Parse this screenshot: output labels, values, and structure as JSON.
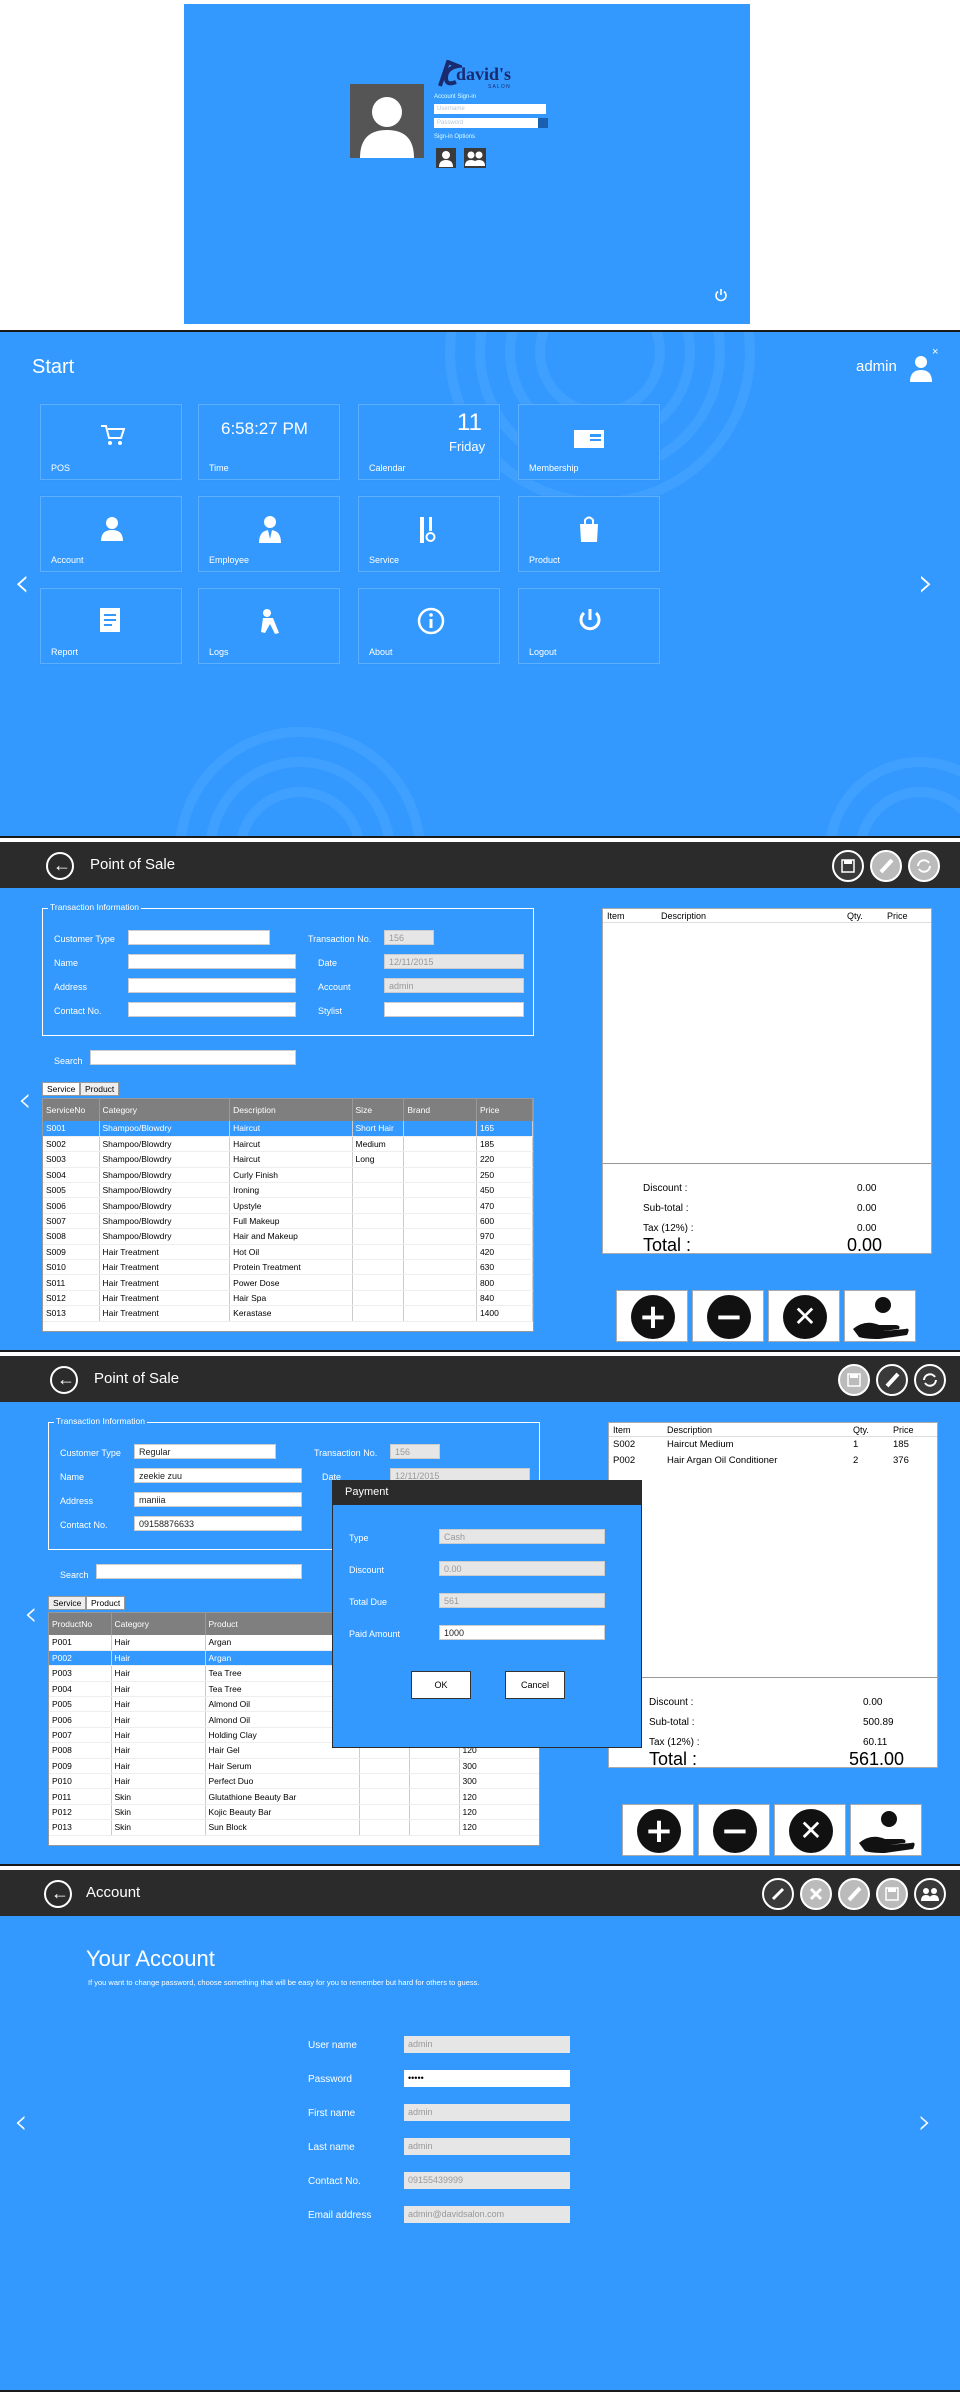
{
  "login": {
    "logo_text": "david's",
    "logo_sub": "S A L O N",
    "signin_label": "Account Sign-in",
    "username_placeholder": "Username",
    "password_placeholder": "Password",
    "signin_as_label": "Sign-in Options"
  },
  "start": {
    "title": "Start",
    "user": "admin",
    "tiles": [
      {
        "label": "POS",
        "icon": "cart-icon"
      },
      {
        "label": "Time",
        "icon": "clock",
        "value": "6:58:27 PM"
      },
      {
        "label": "Calendar",
        "icon": "calendar",
        "day": "11",
        "weekday": "Friday"
      },
      {
        "label": "Membership",
        "icon": "card-icon"
      },
      {
        "label": "Account",
        "icon": "user-icon"
      },
      {
        "label": "Employee",
        "icon": "employee-icon"
      },
      {
        "label": "Service",
        "icon": "scissors-icon"
      },
      {
        "label": "Product",
        "icon": "bag-icon"
      },
      {
        "label": "Report",
        "icon": "report-icon"
      },
      {
        "label": "Logs",
        "icon": "logs-icon"
      },
      {
        "label": "About",
        "icon": "info-icon"
      },
      {
        "label": "Logout",
        "icon": "power-icon"
      }
    ]
  },
  "pos1": {
    "title": "Point of Sale",
    "section": "Transaction Information",
    "labels": {
      "customer_type": "Customer Type",
      "name": "Name",
      "address": "Address",
      "contact": "Contact No.",
      "trans_no": "Transaction No.",
      "date": "Date",
      "account": "Account",
      "stylist": "Stylist",
      "search": "Search"
    },
    "values": {
      "customer_type": "",
      "name": "",
      "address": "",
      "contact": "",
      "trans_no": "156",
      "date": "12/11/2015",
      "account": "admin",
      "stylist": ""
    },
    "tabs": [
      "Service",
      "Product"
    ],
    "columns": [
      "ServiceNo",
      "Category",
      "Description",
      "Size",
      "Brand",
      "Price"
    ],
    "rows": [
      [
        "S001",
        "Shampoo/Blowdry",
        "Haircut",
        "Short Hair",
        "",
        "165"
      ],
      [
        "S002",
        "Shampoo/Blowdry",
        "Haircut",
        "Medium",
        "",
        "185"
      ],
      [
        "S003",
        "Shampoo/Blowdry",
        "Haircut",
        "Long",
        "",
        "220"
      ],
      [
        "S004",
        "Shampoo/Blowdry",
        "Curly Finish",
        "",
        "",
        "250"
      ],
      [
        "S005",
        "Shampoo/Blowdry",
        "Ironing",
        "",
        "",
        "450"
      ],
      [
        "S006",
        "Shampoo/Blowdry",
        "Upstyle",
        "",
        "",
        "470"
      ],
      [
        "S007",
        "Shampoo/Blowdry",
        "Full Makeup",
        "",
        "",
        "600"
      ],
      [
        "S008",
        "Shampoo/Blowdry",
        "Hair and Makeup",
        "",
        "",
        "970"
      ],
      [
        "S009",
        "Hair Treatment",
        "Hot Oil",
        "",
        "",
        "420"
      ],
      [
        "S010",
        "Hair Treatment",
        "Protein Treatment",
        "",
        "",
        "630"
      ],
      [
        "S011",
        "Hair Treatment",
        "Power Dose",
        "",
        "",
        "800"
      ],
      [
        "S012",
        "Hair Treatment",
        "Hair Spa",
        "",
        "",
        "840"
      ],
      [
        "S013",
        "Hair Treatment",
        "Kerastase",
        "",
        "",
        "1400"
      ]
    ],
    "cart_cols": [
      "Item",
      "Description",
      "Qty.",
      "Price"
    ],
    "cart_rows": [],
    "totals": {
      "discount_l": "Discount   :",
      "discount": "0.00",
      "subtotal_l": "Sub-total   :",
      "subtotal": "0.00",
      "tax_l": "Tax (12%)  :",
      "tax": "0.00",
      "total_l": "Total   :",
      "total": "0.00"
    }
  },
  "pos2": {
    "title": "Point of Sale",
    "section": "Transaction Information",
    "values": {
      "customer_type": "Regular",
      "name": "zeekie zuu",
      "address": "maniia",
      "contact": "09158876633",
      "trans_no": "156",
      "date": "12/11/2015"
    },
    "labels": {
      "customer_type": "Customer Type",
      "name": "Name",
      "address": "Address",
      "contact": "Contact No.",
      "trans_no": "Transaction No.",
      "date": "Date",
      "search": "Search"
    },
    "tabs": [
      "Service",
      "Product"
    ],
    "columns": [
      "ProductNo",
      "Category",
      "Product",
      "",
      "",
      ""
    ],
    "rows": [
      [
        "P001",
        "Hair",
        "Argan",
        "",
        "",
        ""
      ],
      [
        "P002",
        "Hair",
        "Argan",
        "",
        "",
        ""
      ],
      [
        "P003",
        "Hair",
        "Tea Tree",
        "",
        "",
        ""
      ],
      [
        "P004",
        "Hair",
        "Tea Tree",
        "",
        "",
        ""
      ],
      [
        "P005",
        "Hair",
        "Almond Oil",
        "",
        "",
        ""
      ],
      [
        "P006",
        "Hair",
        "Almond Oil",
        "",
        "",
        ""
      ],
      [
        "P007",
        "Hair",
        "Holding Clay",
        "",
        "",
        ""
      ],
      [
        "P008",
        "Hair",
        "Hair Gel",
        "",
        "",
        "120"
      ],
      [
        "P009",
        "Hair",
        "Hair Serum",
        "",
        "",
        "300"
      ],
      [
        "P010",
        "Hair",
        "Perfect Duo",
        "",
        "",
        "300"
      ],
      [
        "P011",
        "Skin",
        "Glutathione Beauty Bar",
        "",
        "",
        "120"
      ],
      [
        "P012",
        "Skin",
        "Kojic Beauty Bar",
        "",
        "",
        "120"
      ],
      [
        "P013",
        "Skin",
        "Sun Block",
        "",
        "",
        "120"
      ]
    ],
    "cart_cols": [
      "Item",
      "Description",
      "Qty.",
      "Price"
    ],
    "cart_rows": [
      [
        "S002",
        "Haircut Medium",
        "1",
        "185"
      ],
      [
        "P002",
        "Hair Argan Oil Conditioner",
        "2",
        "376"
      ]
    ],
    "totals": {
      "discount_l": "Discount   :",
      "discount": "0.00",
      "subtotal_l": "Sub-total   :",
      "subtotal": "500.89",
      "tax_l": "Tax (12%)  :",
      "tax": "60.11",
      "total_l": "Total   :",
      "total": "561.00"
    },
    "payment": {
      "title": "Payment",
      "type_l": "Type",
      "type": "Cash",
      "discount_l": "Discount",
      "discount": "0.00",
      "total_due_l": "Total Due",
      "total_due": "561",
      "paid_l": "Paid Amount",
      "paid": "1000",
      "ok": "OK",
      "cancel": "Cancel"
    }
  },
  "account": {
    "title": "Account",
    "heading": "Your Account",
    "subtitle": "If you want to change password, choose something that will be easy for you to remember but hard for others to guess.",
    "fields": [
      {
        "label": "User name",
        "value": "admin"
      },
      {
        "label": "Password",
        "value": "•••••"
      },
      {
        "label": "First name",
        "value": "admin"
      },
      {
        "label": "Last name",
        "value": "admin"
      },
      {
        "label": "Contact No.",
        "value": "09155439999"
      },
      {
        "label": "Email address",
        "value": "admin@davidsalon.com"
      }
    ]
  }
}
